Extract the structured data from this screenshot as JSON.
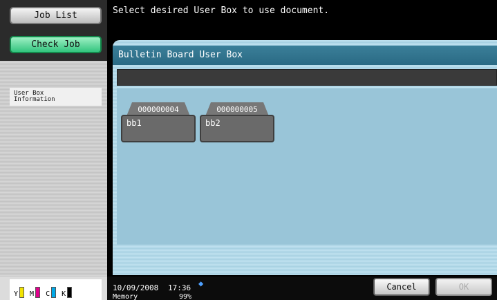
{
  "left": {
    "job_list": "Job List",
    "check_job": "Check Job",
    "info_line1": "User Box",
    "info_line2": "Information"
  },
  "toner": [
    {
      "label": "Y",
      "color": "#f2e300"
    },
    {
      "label": "M",
      "color": "#e0008c"
    },
    {
      "label": "C",
      "color": "#00a9e8"
    },
    {
      "label": "K",
      "color": "#000000"
    }
  ],
  "main": {
    "message": "Select desired User Box to use document.",
    "panel_title": "Bulletin Board User Box",
    "boxes": [
      {
        "number": "000000004",
        "name": "bb1"
      },
      {
        "number": "000000005",
        "name": "bb2"
      }
    ]
  },
  "status": {
    "date": "10/09/2008",
    "time": "17:36",
    "memory_label": "Memory",
    "memory_value": "99%"
  },
  "buttons": {
    "cancel": "Cancel",
    "ok": "OK"
  }
}
